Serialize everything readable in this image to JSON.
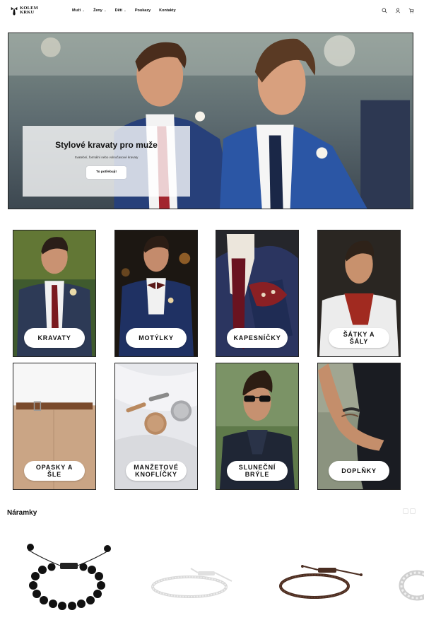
{
  "brand": {
    "logo_text_line1": "KOLEM",
    "logo_text_line2": "KRKU"
  },
  "nav": [
    {
      "label": "Muži",
      "has_dropdown": true
    },
    {
      "label": "Ženy",
      "has_dropdown": true
    },
    {
      "label": "Děti",
      "has_dropdown": true
    },
    {
      "label": "Poukazy",
      "has_dropdown": false
    },
    {
      "label": "Kontakty",
      "has_dropdown": false
    }
  ],
  "header_icons": [
    "search-icon",
    "user-icon",
    "cart-icon"
  ],
  "hero": {
    "title": "Stylové kravaty pro muže",
    "subtitle": "Svatební, formální nebo volnočasové kravaty",
    "button_label": "To potřebuji!"
  },
  "categories": [
    {
      "label": "KRAVATY"
    },
    {
      "label": "MOTÝLKY"
    },
    {
      "label": "KAPESNÍČKY"
    },
    {
      "label": "ŠÁTKY A ŠÁLY"
    },
    {
      "label": "OPASKY A ŠLE"
    },
    {
      "label": "MANŽETOVÉ KNOFLÍČKY"
    },
    {
      "label": "SLUNEČNÍ BRÝLE"
    },
    {
      "label": "DOPLŇKY"
    }
  ],
  "bracelets_section": {
    "title": "Náramky"
  },
  "colors": {
    "navy_suit": "#25365a",
    "tie_red": "#8a1a22",
    "text": "#111111"
  }
}
